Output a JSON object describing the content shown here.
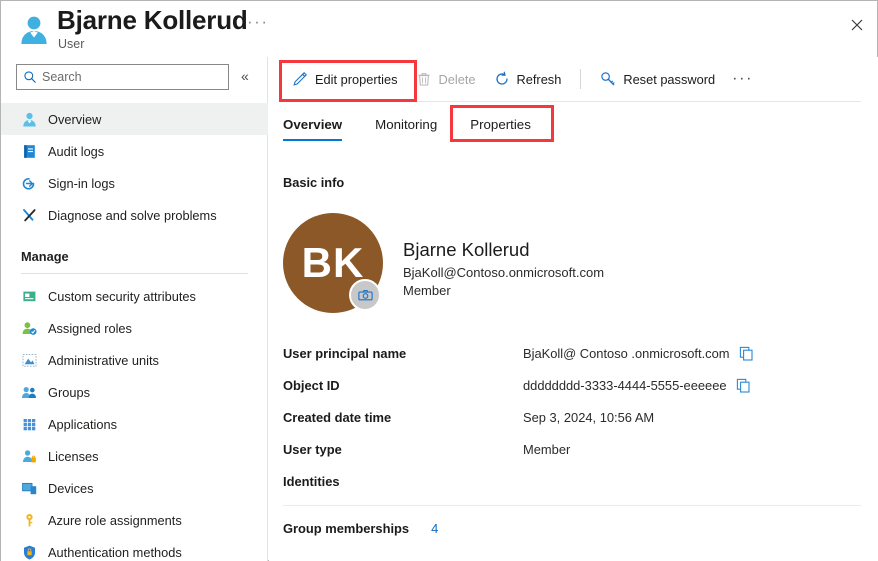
{
  "header": {
    "title": "Bjarne Kollerud",
    "subtitle": "User",
    "ellipsis": "···",
    "close_icon": "close-icon",
    "user_icon": "user-icon"
  },
  "sidebar": {
    "search": {
      "placeholder": "Search",
      "value": "",
      "icon": "search-icon"
    },
    "collapse_icon": "«",
    "items": [
      {
        "label": "Overview",
        "icon": "user-icon",
        "selected": true
      },
      {
        "label": "Audit logs",
        "icon": "audit-log-icon",
        "selected": false
      },
      {
        "label": "Sign-in logs",
        "icon": "sign-in-icon",
        "selected": false
      },
      {
        "label": "Diagnose and solve problems",
        "icon": "wrench-icon",
        "selected": false
      }
    ],
    "manage_section": "Manage",
    "manage_items": [
      {
        "label": "Custom security attributes",
        "icon": "custom-attributes-icon"
      },
      {
        "label": "Assigned roles",
        "icon": "assigned-roles-icon"
      },
      {
        "label": "Administrative units",
        "icon": "administrative-units-icon"
      },
      {
        "label": "Groups",
        "icon": "groups-icon"
      },
      {
        "label": "Applications",
        "icon": "applications-icon"
      },
      {
        "label": "Licenses",
        "icon": "licenses-icon"
      },
      {
        "label": "Devices",
        "icon": "devices-icon"
      },
      {
        "label": "Azure role assignments",
        "icon": "key-icon"
      },
      {
        "label": "Authentication methods",
        "icon": "shield-icon"
      }
    ]
  },
  "toolbar": {
    "edit_properties": "Edit properties",
    "delete": "Delete",
    "refresh": "Refresh",
    "reset_password": "Reset password",
    "ellipsis": "···"
  },
  "tabs": [
    {
      "label": "Overview",
      "active": true
    },
    {
      "label": "Monitoring",
      "active": false
    },
    {
      "label": "Properties",
      "active": false
    }
  ],
  "main": {
    "section_title": "Basic info",
    "avatar_initials": "BK",
    "display_name": "Bjarne Kollerud",
    "upn_short": "BjaKoll@Contoso.onmicrosoft.com",
    "user_type_short": "Member",
    "properties": [
      {
        "label": "User principal name",
        "value": "BjaKoll@ Contoso .onmicrosoft.com",
        "copy": true
      },
      {
        "label": "Object ID",
        "value": "dddddddd-3333-4444-5555-eeeeee",
        "copy": true
      },
      {
        "label": "Created date time",
        "value": "Sep 3, 2024, 10:56 AM",
        "copy": false
      },
      {
        "label": "User type",
        "value": "Member",
        "copy": false
      },
      {
        "label": "Identities",
        "value": "",
        "copy": false
      }
    ],
    "group_memberships_label": "Group memberships",
    "group_memberships_count": "4"
  },
  "colors": {
    "accent": "#0078d4",
    "highlight_red": "#f4383d",
    "avatar_bg": "#8c5827",
    "link": "#0f6cbd"
  }
}
